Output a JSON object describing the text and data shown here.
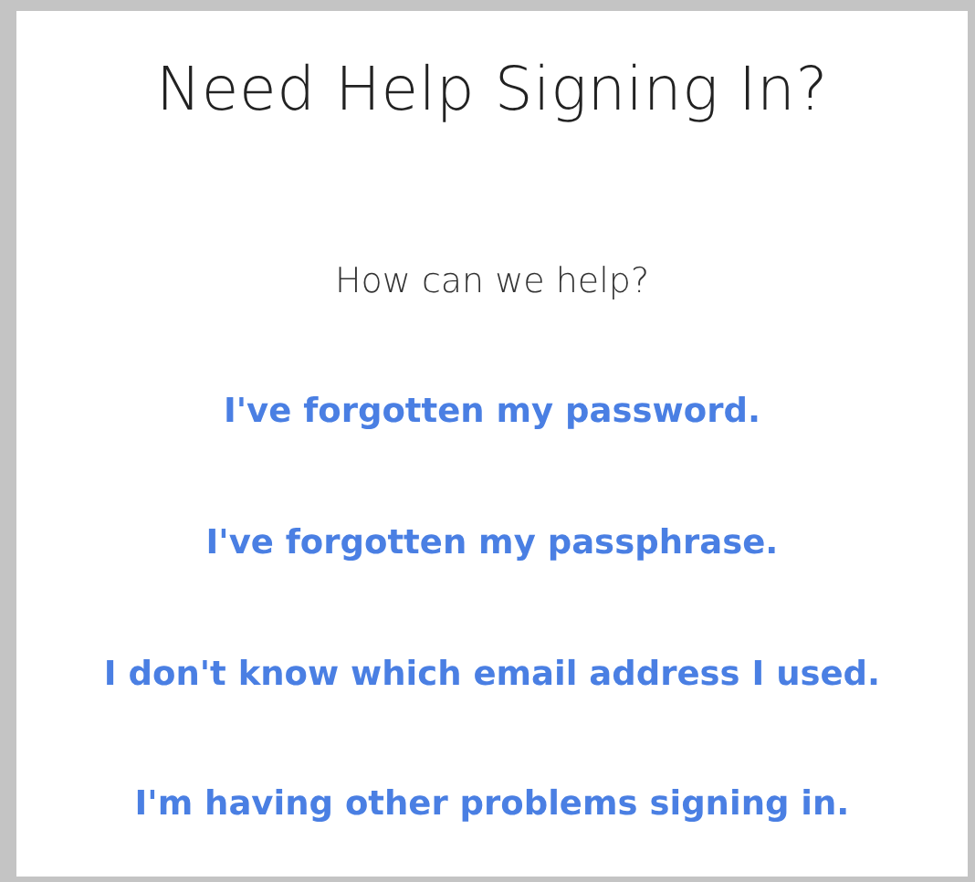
{
  "title": "Need Help Signing In?",
  "prompt": "How can we help?",
  "links": [
    "I've forgotten my password.",
    "I've forgotten my passphrase.",
    "I don't know which email address I used.",
    "I'm having other problems signing in."
  ]
}
